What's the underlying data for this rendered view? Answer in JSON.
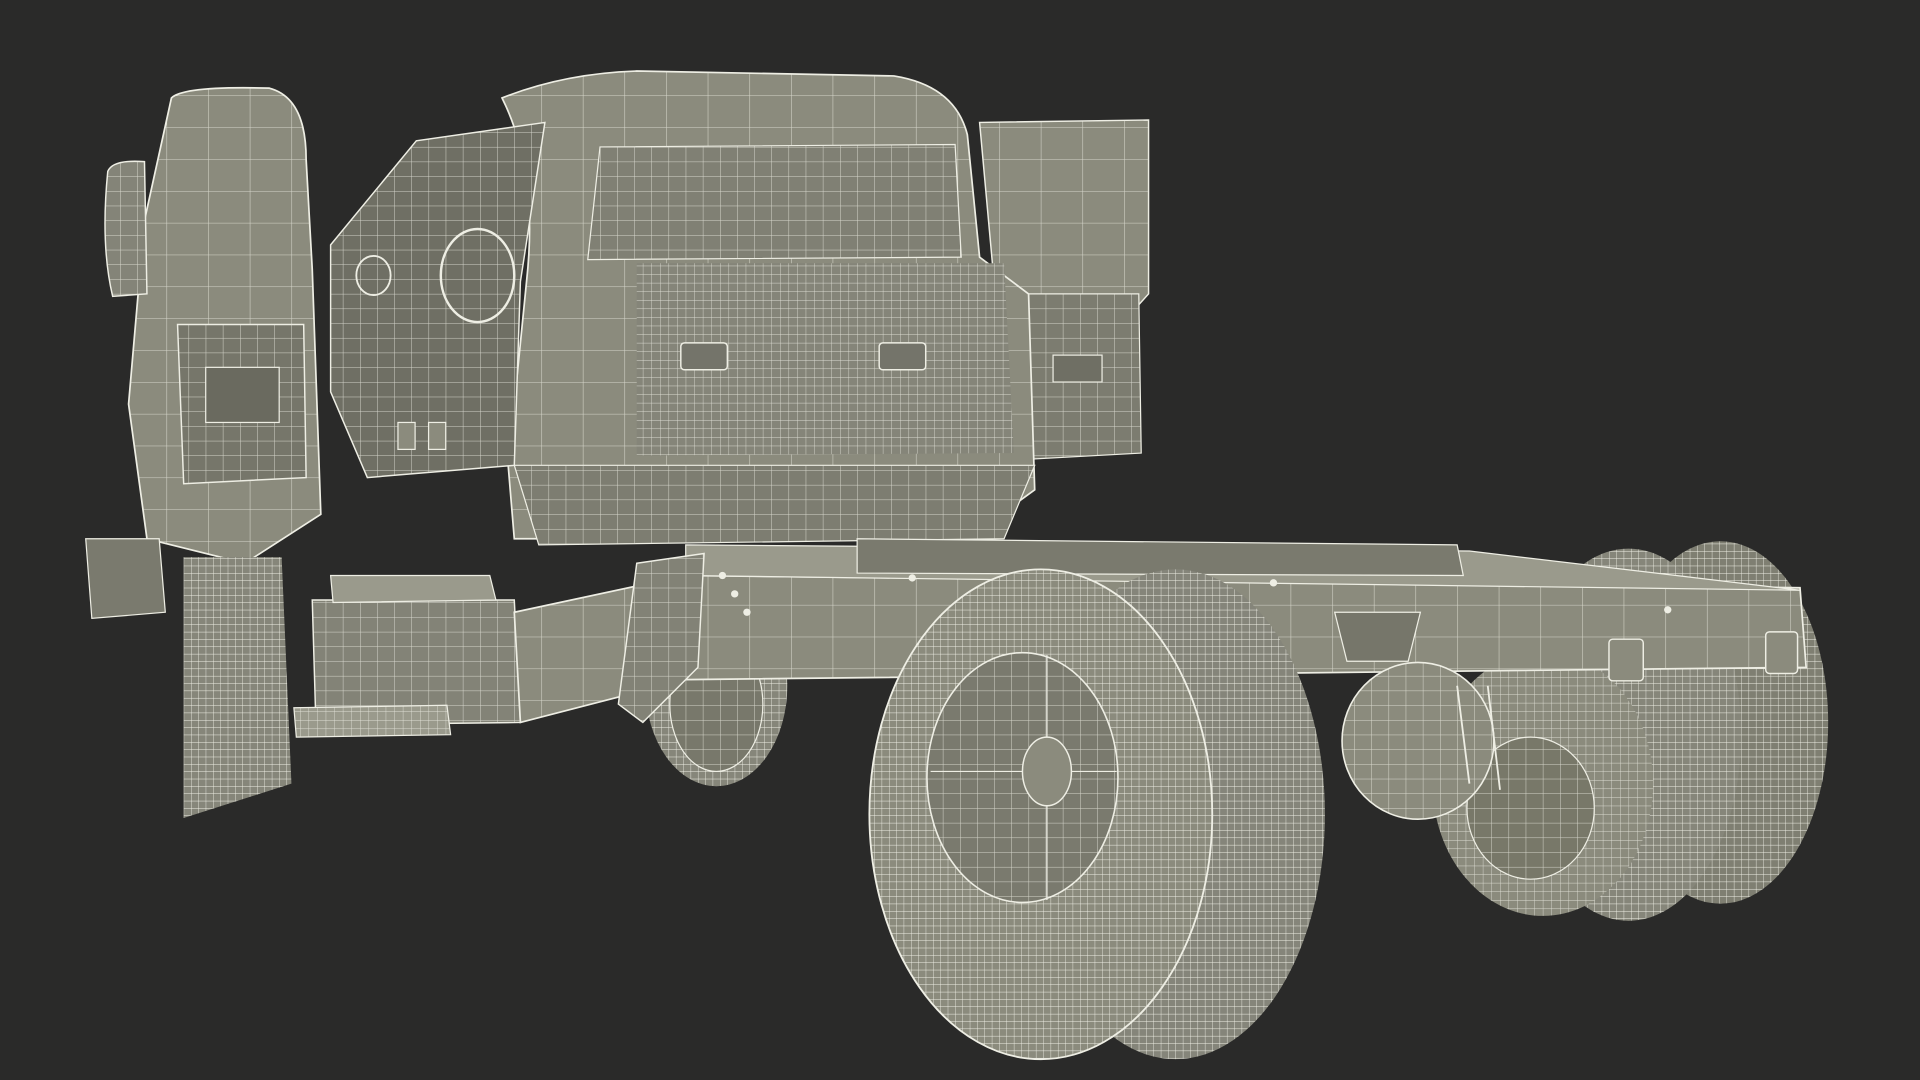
{
  "scene": {
    "background_color": "#2a2a29",
    "surface_color": "#8b8b7d",
    "surface_shadow_color": "#6f6f64",
    "wire_color": "#eeeee4"
  }
}
